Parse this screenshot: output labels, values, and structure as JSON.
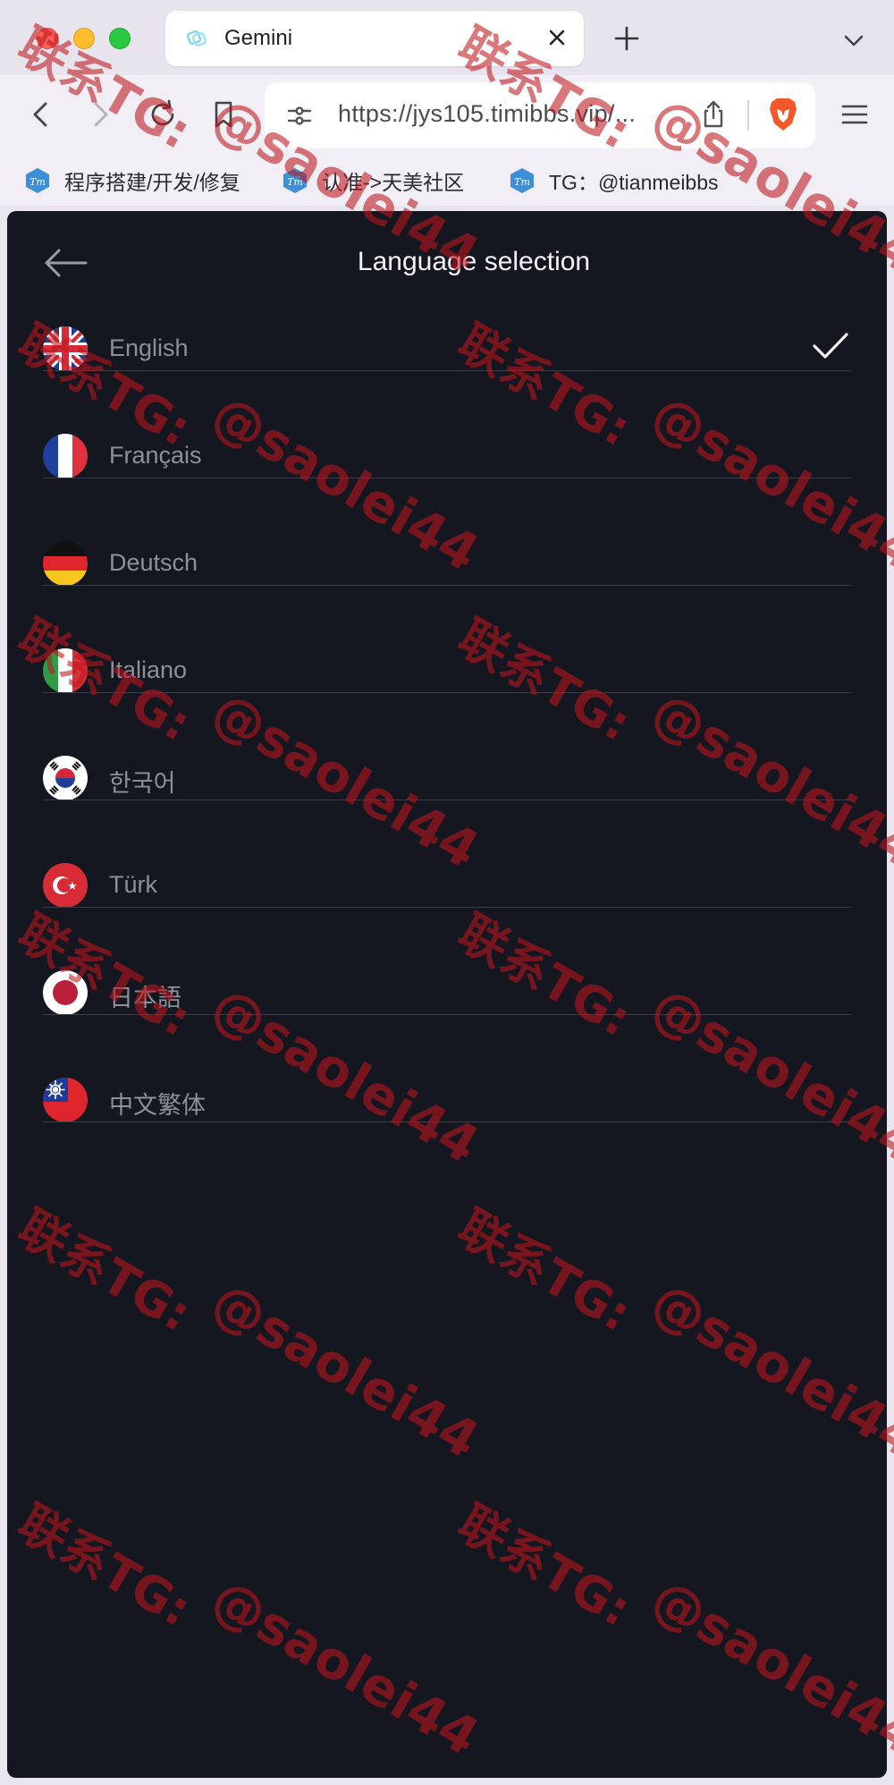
{
  "browser": {
    "tab": {
      "title": "Gemini"
    },
    "url": "https://jys105.timibbs.vip/...",
    "bookmarks": [
      {
        "label": "程序搭建/开发/修复"
      },
      {
        "label": "认准->天美社区"
      },
      {
        "label": "TG：@tianmeibbs"
      }
    ]
  },
  "page": {
    "title": "Language selection",
    "languages": [
      {
        "name": "English",
        "flag": "uk-flag-icon",
        "selected": true
      },
      {
        "name": "Français",
        "flag": "france-flag-icon",
        "selected": false
      },
      {
        "name": "Deutsch",
        "flag": "germany-flag-icon",
        "selected": false
      },
      {
        "name": "Italiano",
        "flag": "italy-flag-icon",
        "selected": false
      },
      {
        "name": "한국어",
        "flag": "korea-flag-icon",
        "selected": false
      },
      {
        "name": "Türk",
        "flag": "turkey-flag-icon",
        "selected": false
      },
      {
        "name": "日本語",
        "flag": "japan-flag-icon",
        "selected": false
      },
      {
        "name": "中文繁体",
        "flag": "taiwan-flag-icon",
        "selected": false
      }
    ]
  },
  "watermark": {
    "line1": "联系TG:",
    "line2": "@saolei44"
  },
  "colors": {
    "page_bg": "#151720",
    "text_muted": "#8d8f99",
    "title": "#f3f3f5",
    "watermark": "#be141c"
  }
}
